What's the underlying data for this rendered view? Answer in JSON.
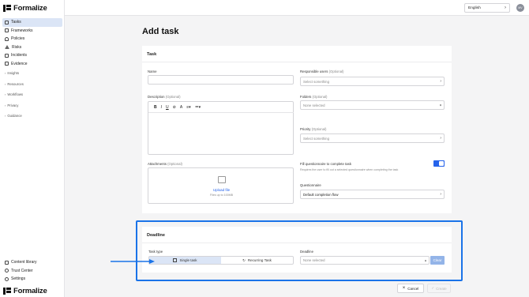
{
  "app": {
    "name": "Formalize"
  },
  "sidebar": {
    "items": [
      {
        "label": "Tasks",
        "icon": "tasks-icon",
        "active": true
      },
      {
        "label": "Frameworks",
        "icon": "frameworks-icon"
      },
      {
        "label": "Policies",
        "icon": "policies-icon"
      },
      {
        "label": "Risks",
        "icon": "risks-icon"
      },
      {
        "label": "Incidents",
        "icon": "incidents-icon"
      },
      {
        "label": "Evidence",
        "icon": "evidence-icon"
      }
    ],
    "groups": [
      "Insights",
      "Resources",
      "Workflows",
      "Privacy",
      "Guidance"
    ],
    "bottom_items": [
      {
        "label": "Content library",
        "icon": "library-icon"
      },
      {
        "label": "Trust Center",
        "icon": "trust-icon"
      },
      {
        "label": "Settings",
        "icon": "gear-icon"
      }
    ]
  },
  "topbar": {
    "language": "English",
    "avatar_initials": "MV"
  },
  "page": {
    "title": "Add task"
  },
  "task_card": {
    "title": "Task",
    "name_label": "Name",
    "description_label": "Description",
    "optional": "(Optional)",
    "attachments_label": "Attachments",
    "upload_link": "Upload file",
    "upload_hint": "Files up to 100MB",
    "responsible_label": "Responsible users",
    "responsible_placeholder": "Select something",
    "folders_label": "Folders",
    "folders_placeholder": "None selected",
    "priority_label": "Priority",
    "priority_placeholder": "Select something",
    "questionnaire_toggle_label": "Fill questionnaire to complete task",
    "questionnaire_toggle_hint": "Requires the user to fill out a selected questionnaire when completing the task",
    "questionnaire_label": "Questionnaire",
    "questionnaire_value": "Default completion flow"
  },
  "deadline_card": {
    "title": "Deadline",
    "task_type_label": "Task type",
    "single_task": "Single task",
    "recurring_task": "Recurring Task",
    "deadline_label": "Deadline",
    "deadline_placeholder": "None selected",
    "clear": "Clear"
  },
  "footer": {
    "cancel": "Cancel",
    "create": "Create"
  },
  "colors": {
    "accent": "#2563eb",
    "highlight": "#1a73e8",
    "active_bg": "#dbe5f6"
  }
}
